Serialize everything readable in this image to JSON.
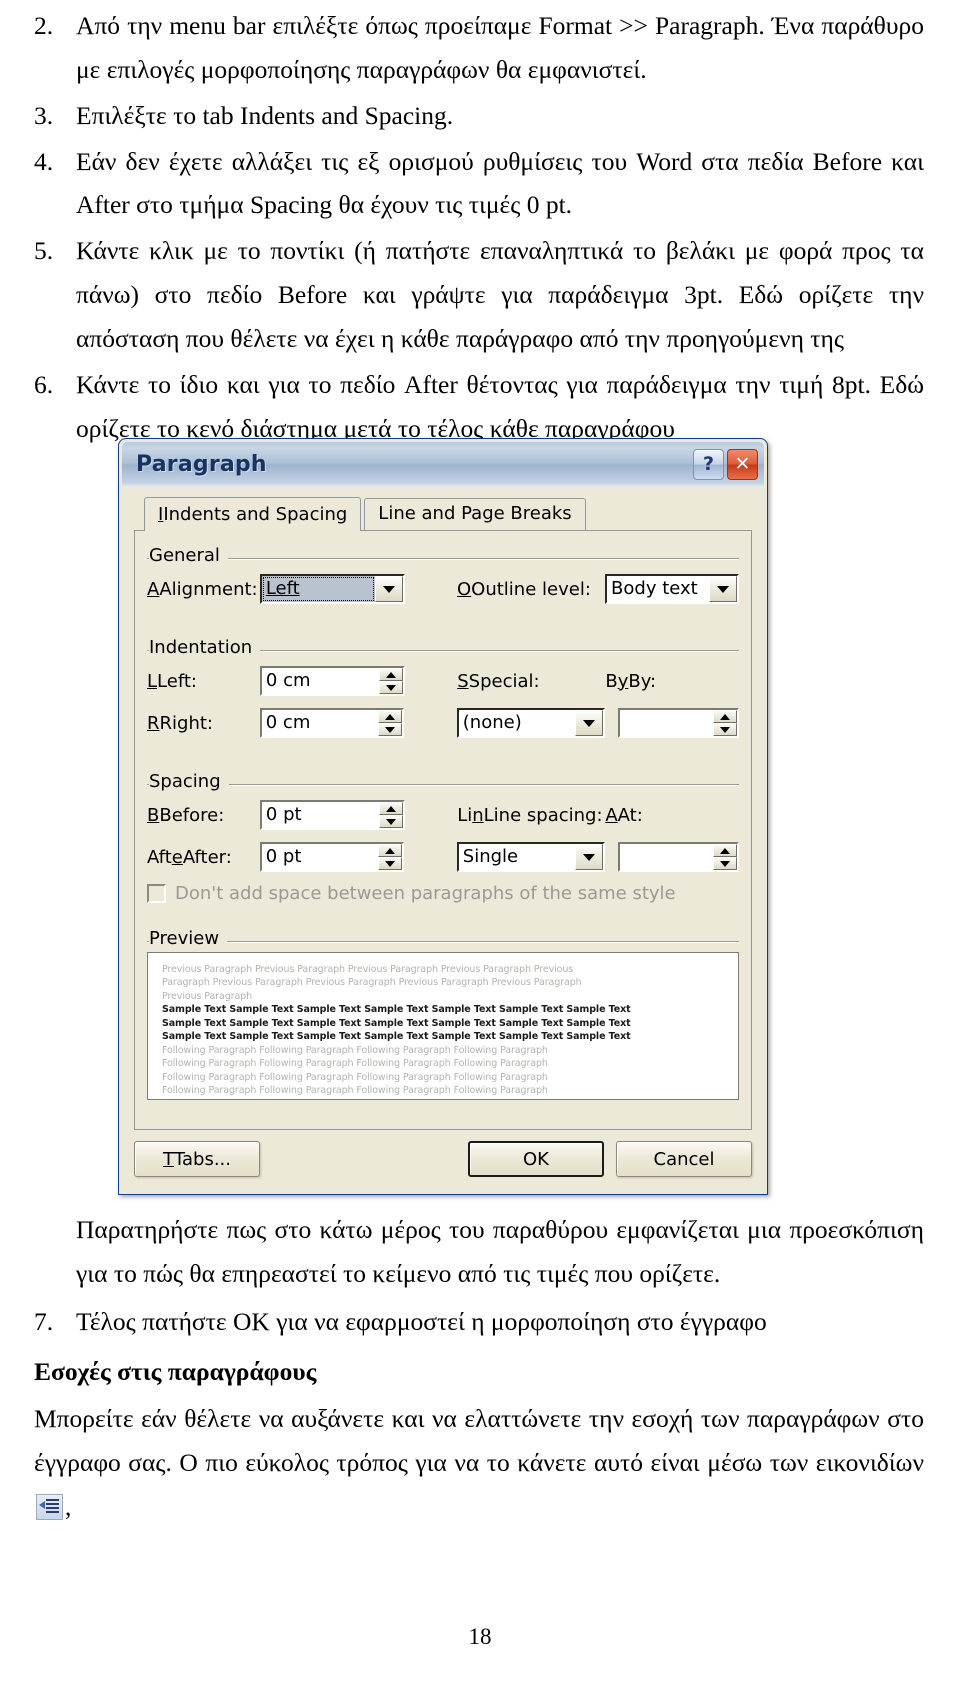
{
  "document": {
    "list_items": [
      {
        "number": "2.",
        "text": "Από την menu bar επιλέξτε όπως προείπαμε Format >> Paragraph. Ένα παράθυρο με επιλογές μορφοποίησης παραγράφων θα εμφανιστεί."
      },
      {
        "number": "3.",
        "text": "Επιλέξτε το tab Indents and Spacing."
      },
      {
        "number": "4.",
        "text": "Εάν δεν έχετε αλλάξει τις εξ ορισμού ρυθμίσεις του Word στα πεδία Before και After στο τμήμα Spacing θα έχουν τις τιμές 0 pt."
      },
      {
        "number": "5.",
        "text": "Κάντε κλικ με το ποντίκι (ή πατήστε επαναληπτικά το βελάκι με φορά προς τα πάνω) στο πεδίο Before και γράψτε για παράδειγμα 3pt. Εδώ ορίζετε την απόσταση που θέλετε να έχει η κάθε παράγραφο από την προηγούμενη της"
      },
      {
        "number": "6.",
        "text": "Κάντε το ίδιο και για το πεδίο After θέτοντας για παράδειγμα την τιμή 8pt. Εδώ ορίζετε το κενό διάστημα μετά το τέλος κάθε παραγράφου"
      }
    ],
    "after_dialog_paragraph": "Παρατηρήστε πως στο κάτω μέρος του παραθύρου εμφανίζεται μια προεσκόπιση για το πώς θα επηρεαστεί το κείμενο από τις τιμές που ορίζετε.",
    "list_item_7": {
      "number": "7.",
      "text": "Τέλος πατήστε ΟΚ για να εφαρμοστεί η μορφοποίηση στο έγγραφο"
    },
    "section_heading": "Εσοχές στις παραγράφους",
    "closing_paragraph_before_icon": "Μπορείτε εάν θέλετε να αυξάνετε και να ελαττώνετε την εσοχή των παραγράφων στο έγγραφο σας. Ο πιο εύκολος τρόπος για να το κάνετε αυτό είναι μέσω των εικονιδίων",
    "closing_paragraph_after_icon": ",",
    "icon_name": "decrease-indent-icon",
    "page_number": "18"
  },
  "dialog": {
    "title": "Paragraph",
    "help_button_label": "?",
    "close_button_label": "✕",
    "tabs": [
      {
        "label": "Indents and Spacing",
        "accel": "I",
        "active": true
      },
      {
        "label": "Line and Page Breaks",
        "accel": "P",
        "active": false
      }
    ],
    "general": {
      "group_label": "General",
      "alignment_label": "Alignment:",
      "alignment_value": "Left",
      "outline_level_label": "Outline level:",
      "outline_level_value": "Body text"
    },
    "indentation": {
      "group_label": "Indentation",
      "left_label": "Left:",
      "left_value": "0 cm",
      "right_label": "Right:",
      "right_value": "0 cm",
      "special_label": "Special:",
      "special_value": "(none)",
      "by_label": "By:",
      "by_value": ""
    },
    "spacing": {
      "group_label": "Spacing",
      "before_label": "Before:",
      "before_value": "0 pt",
      "after_label": "After:",
      "after_value": "0 pt",
      "line_spacing_label": "Line spacing:",
      "line_spacing_value": "Single",
      "at_label": "At:",
      "at_value": "",
      "checkbox_label": "Don't add space between paragraphs of the same style",
      "checkbox_checked": false,
      "checkbox_enabled": false
    },
    "preview": {
      "group_label": "Preview",
      "previous_lines": [
        "Previous Paragraph Previous Paragraph Previous Paragraph Previous Paragraph Previous",
        "Paragraph Previous Paragraph Previous Paragraph Previous Paragraph Previous Paragraph",
        "Previous Paragraph"
      ],
      "sample_lines": [
        "Sample Text Sample Text Sample Text Sample Text Sample Text Sample Text Sample Text",
        "Sample Text Sample Text Sample Text Sample Text Sample Text Sample Text Sample Text",
        "Sample Text Sample Text Sample Text Sample Text Sample Text Sample Text Sample Text"
      ],
      "following_lines": [
        "Following Paragraph Following Paragraph Following Paragraph Following Paragraph",
        "Following Paragraph Following Paragraph Following Paragraph Following Paragraph",
        "Following Paragraph Following Paragraph Following Paragraph Following Paragraph",
        "Following Paragraph Following Paragraph Following Paragraph Following Paragraph"
      ]
    },
    "buttons": {
      "tabs_label": "Tabs...",
      "tabs_accel": "T",
      "ok_label": "OK",
      "cancel_label": "Cancel"
    }
  },
  "colors": {
    "dialog_face": "#ece9d8",
    "title_blue": "#17335f",
    "close_red": "#d4481e",
    "field_white": "#ffffff",
    "selection_gray": "#b9c2cf"
  }
}
